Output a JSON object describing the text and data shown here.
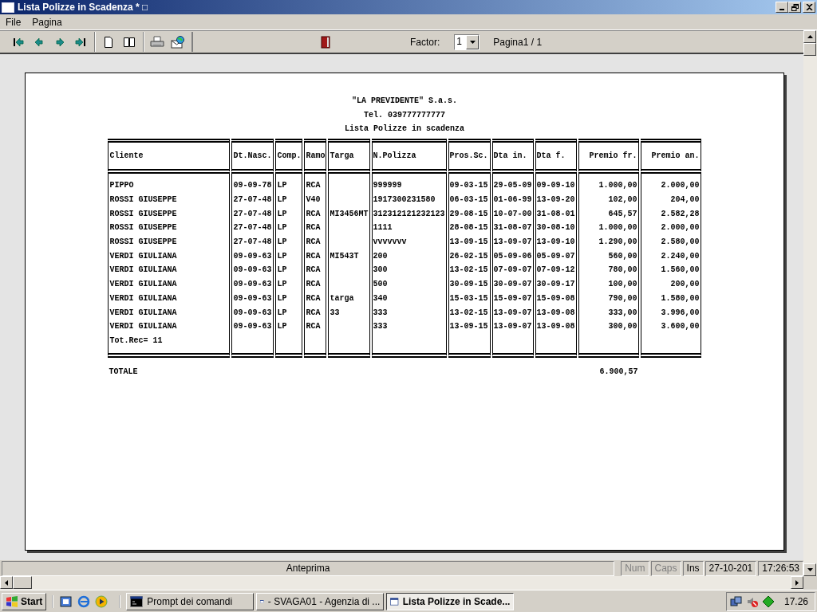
{
  "window": {
    "title": "Lista Polizze in Scadenza * □"
  },
  "menu": [
    "File",
    "Pagina"
  ],
  "toolbar": {
    "factor_label": "Factor:",
    "factor_value": "1",
    "page_label": "Pagina1 / 1"
  },
  "report": {
    "header_lines": [
      "\"LA PREVIDENTE\" S.a.s.",
      "Tel. 039777777777",
      "Lista Polizze in scadenza"
    ],
    "columns": [
      {
        "label": "Cliente",
        "kind": "text",
        "footer": "Tot.Rec= 11",
        "total": "TOTALE"
      },
      {
        "label": "Dt.Nasc.",
        "kind": "text"
      },
      {
        "label": "Comp.",
        "kind": "text"
      },
      {
        "label": "Ramo",
        "kind": "text"
      },
      {
        "label": "Targa",
        "kind": "text"
      },
      {
        "label": "N.Polizza",
        "kind": "text"
      },
      {
        "label": "Pros.Sc.",
        "kind": "text"
      },
      {
        "label": "Dta in.",
        "kind": "text"
      },
      {
        "label": "Dta f.",
        "kind": "text"
      },
      {
        "label": "Premio fr.",
        "kind": "amount",
        "total": "6.900,57"
      },
      {
        "label": "Premio an.",
        "kind": "amount"
      }
    ],
    "rows": [
      [
        "PIPPO",
        "09-09-78",
        "LP",
        "RCA",
        "",
        "999999",
        "09-03-15",
        "29-05-09",
        "09-09-10",
        "1.000,00",
        "2.000,00"
      ],
      [
        "ROSSI GIUSEPPE",
        "27-07-48",
        "LP",
        "V40",
        "",
        "1917300231580",
        "06-03-15",
        "01-06-99",
        "13-09-20",
        "102,00",
        "204,00"
      ],
      [
        "ROSSI GIUSEPPE",
        "27-07-48",
        "LP",
        "RCA",
        "MI3456MT",
        "312312121232123",
        "29-08-15",
        "10-07-00",
        "31-08-01",
        "645,57",
        "2.582,28"
      ],
      [
        "ROSSI GIUSEPPE",
        "27-07-48",
        "LP",
        "RCA",
        "",
        "1111",
        "28-08-15",
        "31-08-07",
        "30-08-10",
        "1.000,00",
        "2.000,00"
      ],
      [
        "ROSSI GIUSEPPE",
        "27-07-48",
        "LP",
        "RCA",
        "",
        "vvvvvvv",
        "13-09-15",
        "13-09-07",
        "13-09-10",
        "1.290,00",
        "2.580,00"
      ],
      [
        "VERDI GIULIANA",
        "09-09-63",
        "LP",
        "RCA",
        "MI543T",
        "200",
        "26-02-15",
        "05-09-06",
        "05-09-07",
        "560,00",
        "2.240,00"
      ],
      [
        "VERDI GIULIANA",
        "09-09-63",
        "LP",
        "RCA",
        "",
        "300",
        "13-02-15",
        "07-09-07",
        "07-09-12",
        "780,00",
        "1.560,00"
      ],
      [
        "VERDI GIULIANA",
        "09-09-63",
        "LP",
        "RCA",
        "",
        "500",
        "30-09-15",
        "30-09-07",
        "30-09-17",
        "100,00",
        "200,00"
      ],
      [
        "VERDI GIULIANA",
        "09-09-63",
        "LP",
        "RCA",
        "targa",
        "340",
        "15-03-15",
        "15-09-07",
        "15-09-08",
        "790,00",
        "1.580,00"
      ],
      [
        "VERDI GIULIANA",
        "09-09-63",
        "LP",
        "RCA",
        "33",
        "333",
        "13-02-15",
        "13-09-07",
        "13-09-08",
        "333,00",
        "3.996,00"
      ],
      [
        "VERDI GIULIANA",
        "09-09-63",
        "LP",
        "RCA",
        "",
        "333",
        "13-09-15",
        "13-09-07",
        "13-09-08",
        "300,00",
        "3.600,00"
      ]
    ]
  },
  "status_bar": {
    "message": "Anteprima",
    "panels": [
      {
        "text": "Num",
        "on": false
      },
      {
        "text": "Caps",
        "on": false
      },
      {
        "text": "Ins",
        "on": true
      },
      {
        "text": "27-10-201",
        "on": true
      },
      {
        "text": "17:26:53",
        "on": true
      }
    ]
  },
  "taskbar": {
    "start": "Start",
    "tasks": [
      {
        "label": "Prompt dei comandi",
        "kind": "console",
        "selected": false
      },
      {
        "label": "- SVAGA01 - Agenzia di ...",
        "kind": "window",
        "selected": false
      },
      {
        "label": "Lista Polizze in Scade...",
        "kind": "window",
        "selected": true
      }
    ],
    "clock": "17.26"
  }
}
